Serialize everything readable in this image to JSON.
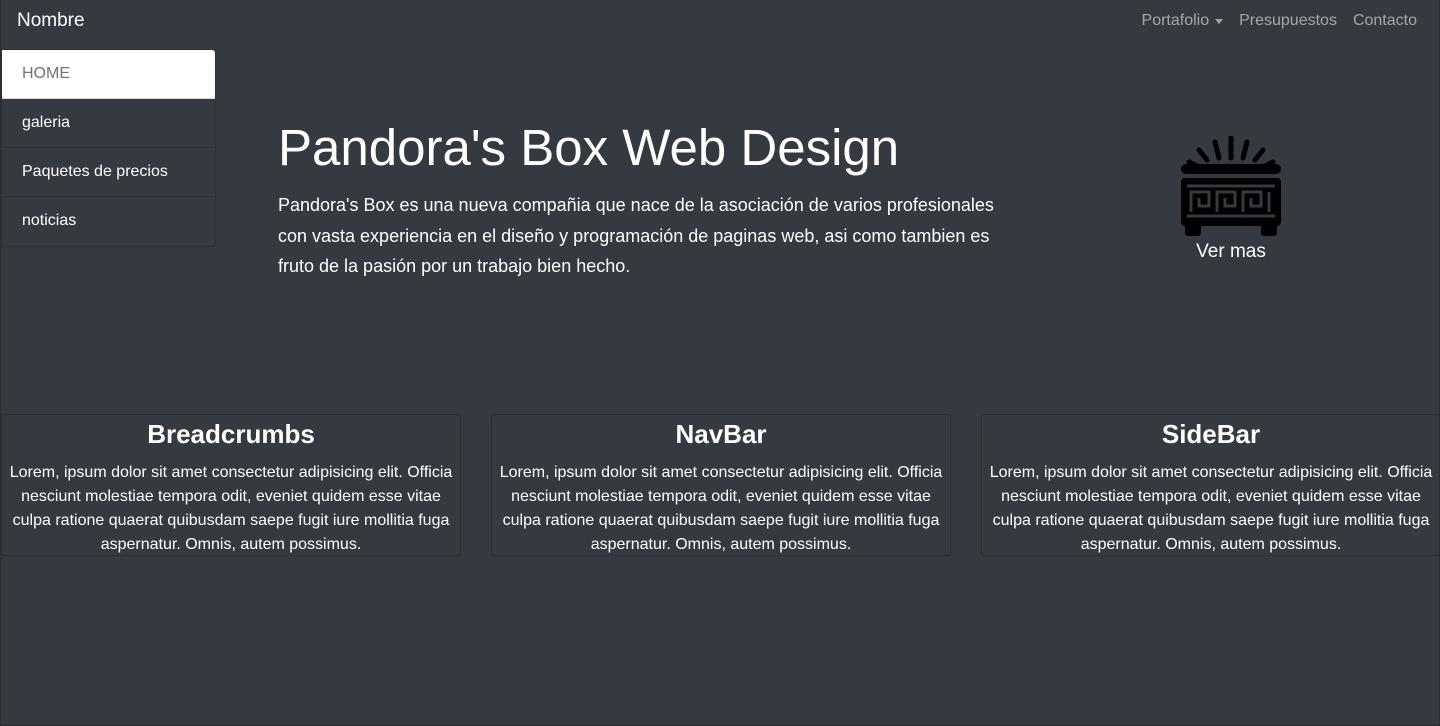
{
  "navbar": {
    "brand": "Nombre",
    "links": [
      {
        "label": "Portafolio",
        "has_dropdown": true
      },
      {
        "label": "Presupuestos"
      },
      {
        "label": "Contacto"
      }
    ]
  },
  "sidebar": {
    "items": [
      {
        "label": "HOME",
        "active": true
      },
      {
        "label": "galeria"
      },
      {
        "label": "Paquetes de precios"
      },
      {
        "label": "noticias"
      }
    ]
  },
  "hero": {
    "title": "Pandora's Box Web Design",
    "text": "Pandora's Box es una nueva compañia que nace de la asociación de varios profesionales con vasta experiencia en el diseño y programación de paginas web, asi como tambien es fruto de la pasión por un trabajo bien hecho.",
    "logo_icon": "pandora-box-icon",
    "link_label": "Ver mas"
  },
  "cards": [
    {
      "title": "Breadcrumbs",
      "text": "Lorem, ipsum dolor sit amet consectetur adipisicing elit. Officia nesciunt molestiae tempora odit, eveniet quidem esse vitae culpa ratione quaerat quibusdam saepe fugit iure mollitia fuga aspernatur. Omnis, autem possimus."
    },
    {
      "title": "NavBar",
      "text": "Lorem, ipsum dolor sit amet consectetur adipisicing elit. Officia nesciunt molestiae tempora odit, eveniet quidem esse vitae culpa ratione quaerat quibusdam saepe fugit iure mollitia fuga aspernatur. Omnis, autem possimus."
    },
    {
      "title": "SideBar",
      "text": "Lorem, ipsum dolor sit amet consectetur adipisicing elit. Officia nesciunt molestiae tempora odit, eveniet quidem esse vitae culpa ratione quaerat quibusdam saepe fugit iure mollitia fuga aspernatur. Omnis, autem possimus."
    }
  ],
  "colors": {
    "background": "#343a40",
    "active_item_bg": "#ffffff",
    "active_item_text": "#6c757d",
    "nav_link": "#9a9da0"
  }
}
